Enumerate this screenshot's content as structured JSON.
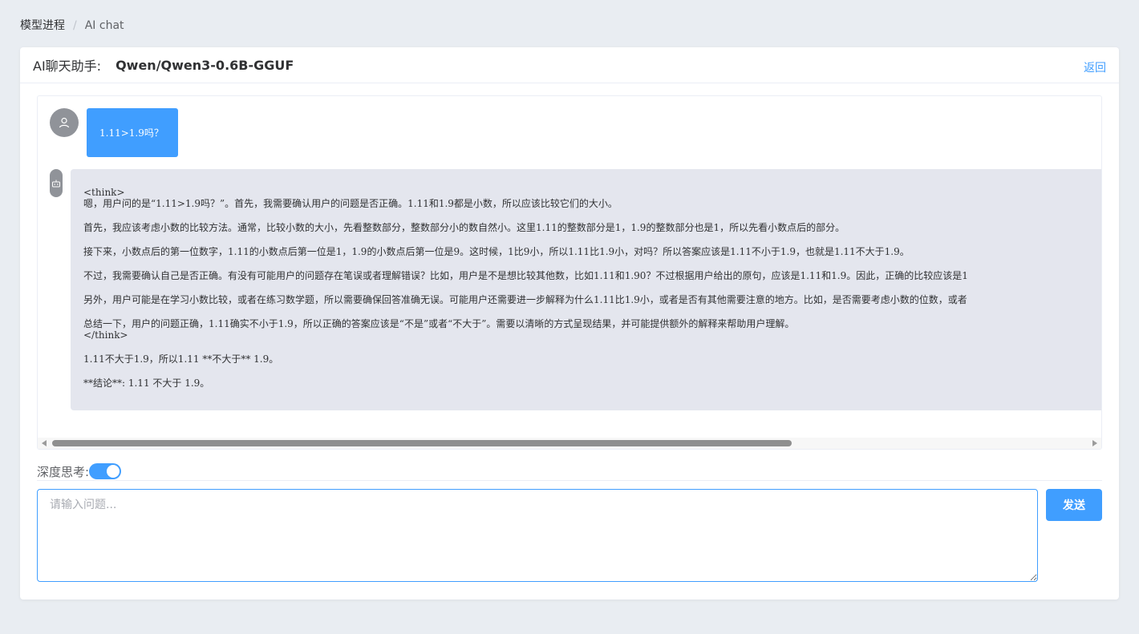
{
  "breadcrumb": {
    "parent": "模型进程",
    "separator": "/",
    "current": "AI chat"
  },
  "header": {
    "title_label": "AI聊天助手:",
    "model_name": "Qwen/Qwen3-0.6B-GGUF",
    "back_label": "返回"
  },
  "chat": {
    "messages": [
      {
        "role": "user",
        "avatar_icon": "user-icon",
        "text": "1.11>1.9吗？"
      },
      {
        "role": "assistant",
        "avatar_icon": "robot-icon",
        "lines": [
          "<think>",
          "嗯，用户问的是“1.11>1.9吗？”。首先，我需要确认用户的问题是否正确。1.11和1.9都是小数，所以应该比较它们的大小。",
          "首先，我应该考虑小数的比较方法。通常，比较小数的大小，先看整数部分，整数部分小的数自然小。这里1.11的整数部分是1，1.9的整数部分也是1，所以先看小数点后的部分。",
          "接下来，小数点后的第一位数字，1.11的小数点后第一位是1，1.9的小数点后第一位是9。这时候，1比9小，所以1.11比1.9小，对吗？所以答案应该是1.11不小于1.9，也就是1.11不大于1.9。",
          "不过，我需要确认自己是否正确。有没有可能用户的问题存在笔误或者理解错误？比如，用户是不是想比较其他数，比如1.11和1.90？不过根据用户给出的原句，应该是1.11和1.9。因此，正确的比较应该是1",
          "另外，用户可能是在学习小数比较，或者在练习数学题，所以需要确保回答准确无误。可能用户还需要进一步解释为什么1.11比1.9小，或者是否有其他需要注意的地方。比如，是否需要考虑小数的位数，或者",
          "总结一下，用户的问题正确，1.11确实不小于1.9，所以正确的答案应该是“不是”或者“不大于”。需要以清晰的方式呈现结果，并可能提供额外的解释来帮助用户理解。",
          "</think>",
          "1.11不大于1.9，所以1.11 **不大于** 1.9。",
          "**结论**: 1.11 不大于 1.9。"
        ]
      }
    ]
  },
  "controls": {
    "deep_think_label": "深度思考:",
    "deep_think_enabled": true,
    "input_placeholder": "请输入问题...",
    "input_value": "",
    "send_label": "发送"
  },
  "colors": {
    "accent": "#409eff",
    "page_bg": "#e9edf2",
    "bot_bubble_bg": "#e4e6ee",
    "avatar_bg": "#909399"
  }
}
